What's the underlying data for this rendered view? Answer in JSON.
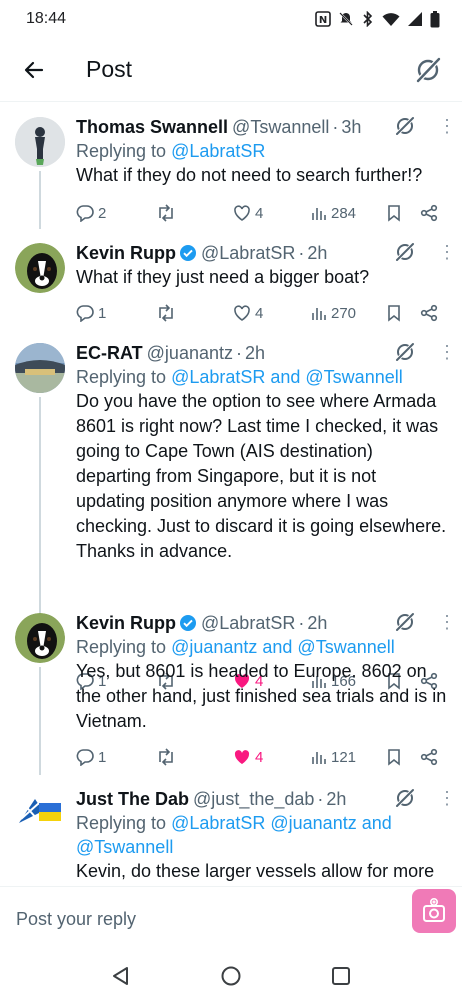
{
  "status_bar": {
    "time": "18:44"
  },
  "header": {
    "title": "Post"
  },
  "replies": [
    {
      "name": "Thomas Swannell",
      "handle": "@Tswannell",
      "time": "3h",
      "verified": false,
      "replying_prefix": "Replying to ",
      "replying_to": "@LabratSR",
      "text": "What if they do not need to search further!?",
      "reply_count": "2",
      "retweet_count": "",
      "like_count": "4",
      "liked": false,
      "views": "284"
    },
    {
      "name": "Kevin Rupp",
      "handle": "@LabratSR",
      "time": "2h",
      "verified": true,
      "replying_prefix": "",
      "replying_to": "",
      "text": "What if they just need a bigger boat?",
      "reply_count": "1",
      "retweet_count": "",
      "like_count": "4",
      "liked": false,
      "views": "270"
    },
    {
      "name": "EC-RAT",
      "handle": "@juanantz",
      "time": "2h",
      "verified": false,
      "replying_prefix": "Replying to ",
      "replying_to": "@LabratSR and @Tswannell",
      "text": "Do you have the option to see where Armada 8601 is right now? Last time I checked, it was going to Cape Town (AIS destination) departing from Singapore, but it is not updating position anymore where I was checking. Just to discard it is going elsewhere. Thanks in advance.",
      "reply_count": "1",
      "retweet_count": "",
      "like_count": "4",
      "liked": true,
      "views": "166"
    },
    {
      "name": "Kevin Rupp",
      "handle": "@LabratSR",
      "time": "2h",
      "verified": true,
      "replying_prefix": "Replying to ",
      "replying_to": "@juanantz and @Tswannell",
      "text": "Yes, but 8601 is headed to Europe. 8602 on the other hand, just finished sea trials and is in Vietnam.",
      "reply_count": "1",
      "retweet_count": "",
      "like_count": "4",
      "liked": true,
      "views": "121"
    },
    {
      "name": "Just The Dab",
      "handle": "@just_the_dab",
      "time": "2h",
      "verified": false,
      "replying_prefix": "Replying to ",
      "replying_to": "@LabratSR @juanantz and @Tswannell",
      "text": "Kevin, do these larger vessels allow for more"
    }
  ],
  "compose": {
    "placeholder": "Post your reply"
  },
  "colors": {
    "accent": "#1d9bf0",
    "like": "#f91880",
    "muted": "#536471"
  }
}
